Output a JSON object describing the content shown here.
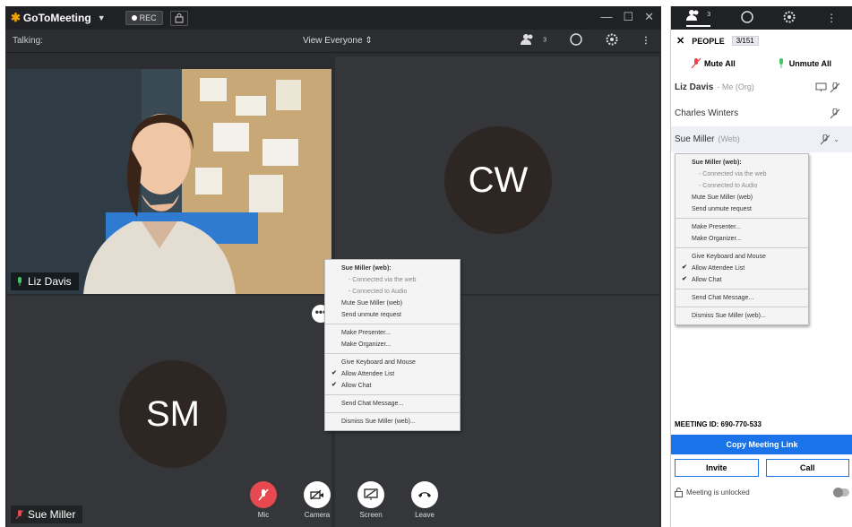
{
  "titlebar": {
    "brand": "GoToMeeting",
    "rec_label": "REC",
    "controls": [
      "—",
      "☐",
      "✕"
    ]
  },
  "toolbar": {
    "talking_label": "Talking:",
    "view_label": "View Everyone",
    "people_count": "3"
  },
  "tiles": {
    "liz": {
      "name": "Liz Davis"
    },
    "cw": {
      "initials": "CW"
    },
    "sm": {
      "initials": "SM",
      "name": "Sue Miller"
    }
  },
  "controls": [
    {
      "label": "Mic"
    },
    {
      "label": "Camera"
    },
    {
      "label": "Screen"
    },
    {
      "label": "Leave"
    }
  ],
  "menu": {
    "header": "Sue Miller (web):",
    "connected_web": "- Connected via the web",
    "connected_audio": "- Connected to Audio",
    "mute": "Mute Sue Miller (web)",
    "unmute_request": "Send unmute request",
    "make_presenter": "Make Presenter...",
    "make_organizer": "Make Organizer...",
    "give_kb": "Give Keyboard and Mouse",
    "allow_attendee": "Allow Attendee List",
    "allow_chat": "Allow Chat",
    "send_chat": "Send Chat Message...",
    "dismiss": "Dismiss Sue Miller (web)..."
  },
  "panel": {
    "tab_people_count": "3",
    "header": "PEOPLE",
    "count": "3/151",
    "mute_all": "Mute All",
    "unmute_all": "Unmute All",
    "people": [
      {
        "name": "Liz Davis",
        "sub": "- Me (Org)"
      },
      {
        "name": "Charles Winters",
        "sub": ""
      },
      {
        "name": "Sue Miller",
        "sub": "(Web)"
      }
    ],
    "meeting_id": "MEETING ID:  690-770-533",
    "copy_link": "Copy Meeting Link",
    "invite": "Invite",
    "call": "Call",
    "lock_status": "Meeting is unlocked"
  },
  "colors": {
    "accent": "#1a73e8",
    "leave_red": "#e8484f",
    "brand_orange": "#f0a500"
  }
}
